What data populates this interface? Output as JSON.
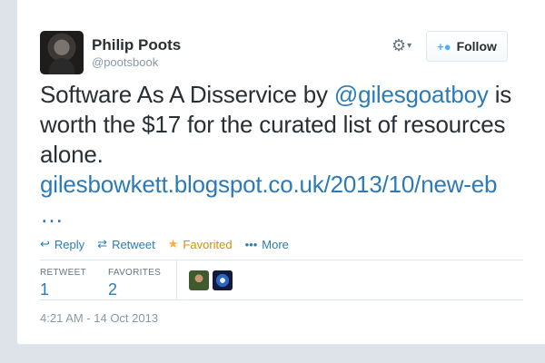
{
  "author": {
    "name": "Philip Poots",
    "handle": "@pootsbook"
  },
  "header": {
    "gear_icon": "⚙",
    "gear_chevron": "▾",
    "follow_label": "Follow",
    "follow_icon": "+👤"
  },
  "tweet": {
    "text_before": "Software As A Disservice by ",
    "mention": "@gilesgoatboy",
    "text_after": " is worth the $17 for the curated list of resources alone.",
    "link": "gilesbowkett.blogspot.co.uk/2013/10/new-eb",
    "ellipsis": "…"
  },
  "actions": {
    "reply": "Reply",
    "reply_icon": "↩",
    "retweet": "Retweet",
    "retweet_icon": "⇄",
    "favorited": "Favorited",
    "favorited_icon": "★",
    "more": "More",
    "more_icon": "•••"
  },
  "stats": {
    "retweet_label": "RETWEET",
    "retweet_count": "1",
    "favorites_label": "FAVORITES",
    "favorites_count": "2"
  },
  "timestamp": "4:21 AM - 14 Oct 2013",
  "colors": {
    "link": "#2b7bb9",
    "favorited": "#cc9500",
    "text": "#292f33",
    "muted": "#8899a6"
  }
}
